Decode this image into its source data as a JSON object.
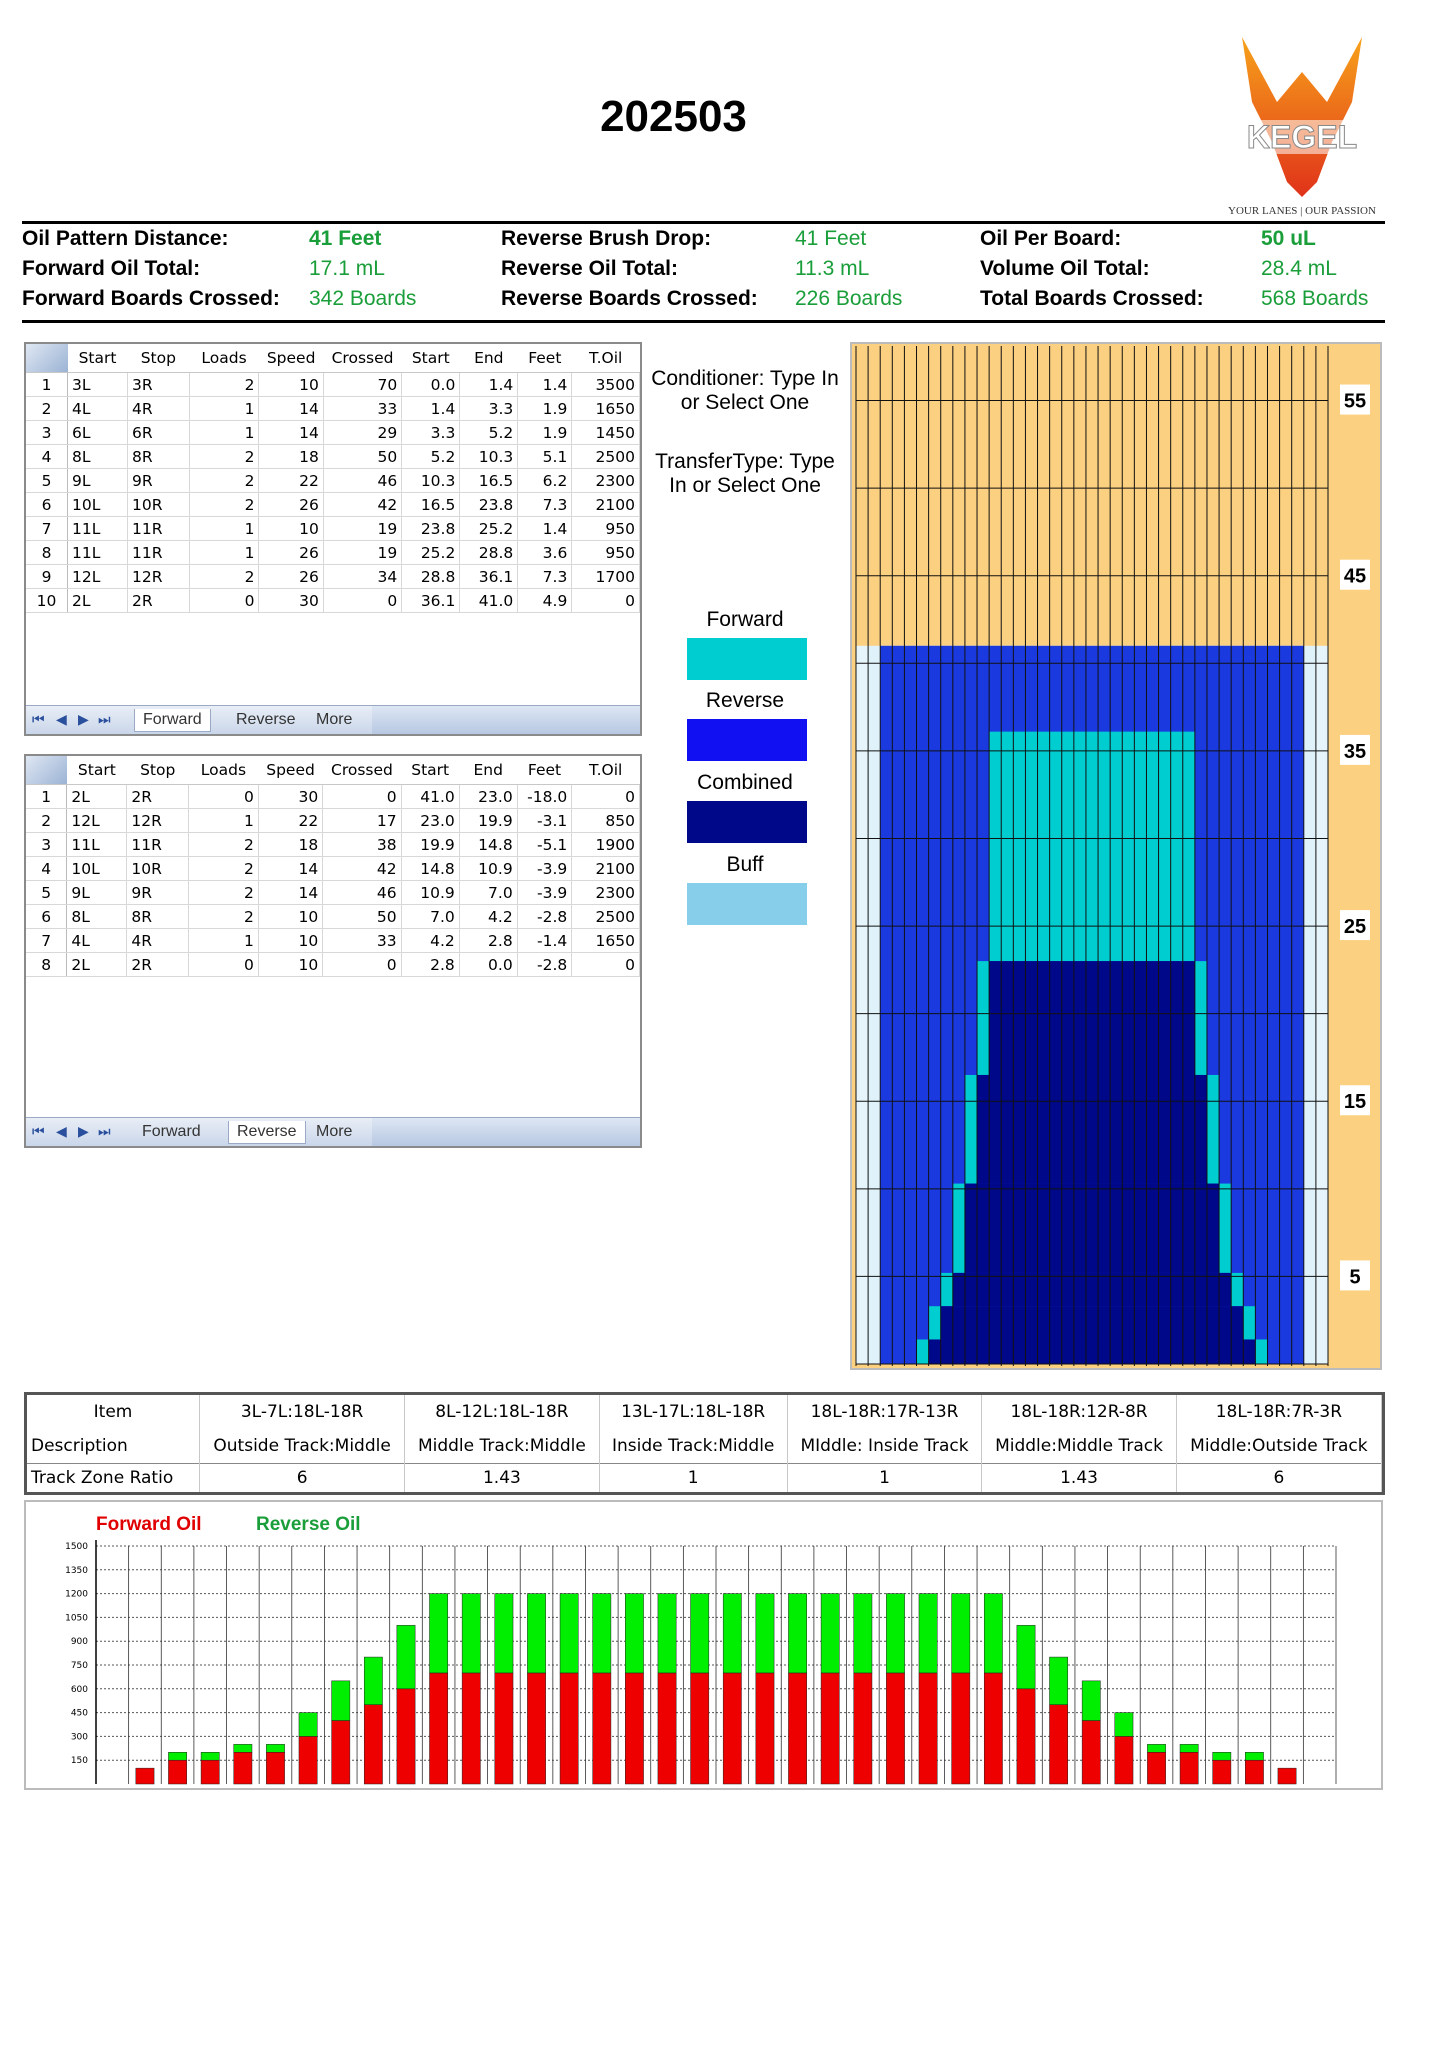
{
  "title": "202503",
  "logo": {
    "text": "KEGEL",
    "tagline": "YOUR LANES | OUR PASSION"
  },
  "summary": [
    [
      {
        "label": "Oil Pattern Distance:",
        "value": "41 Feet",
        "bold": true
      },
      {
        "label": "Reverse Brush Drop:",
        "value": "41 Feet",
        "bold": false
      },
      {
        "label": "Oil Per Board:",
        "value": "50 uL",
        "bold": true
      }
    ],
    [
      {
        "label": "Forward Oil Total:",
        "value": "17.1 mL",
        "bold": false
      },
      {
        "label": "Reverse Oil Total:",
        "value": "11.3 mL",
        "bold": false
      },
      {
        "label": "Volume Oil Total:",
        "value": "28.4 mL",
        "bold": false
      }
    ],
    [
      {
        "label": "Forward Boards Crossed:",
        "value": "342 Boards",
        "bold": false
      },
      {
        "label": "Reverse Boards Crossed:",
        "value": "226 Boards",
        "bold": false
      },
      {
        "label": "Total Boards Crossed:",
        "value": "568 Boards",
        "bold": false
      }
    ]
  ],
  "grid_headers": [
    "Start",
    "Stop",
    "Loads",
    "Speed",
    "Crossed",
    "Start",
    "End",
    "Feet",
    "T.Oil"
  ],
  "forward_rows": [
    [
      "1",
      "3L",
      "3R",
      "2",
      "10",
      "70",
      "0.0",
      "1.4",
      "1.4",
      "3500"
    ],
    [
      "2",
      "4L",
      "4R",
      "1",
      "14",
      "33",
      "1.4",
      "3.3",
      "1.9",
      "1650"
    ],
    [
      "3",
      "6L",
      "6R",
      "1",
      "14",
      "29",
      "3.3",
      "5.2",
      "1.9",
      "1450"
    ],
    [
      "4",
      "8L",
      "8R",
      "2",
      "18",
      "50",
      "5.2",
      "10.3",
      "5.1",
      "2500"
    ],
    [
      "5",
      "9L",
      "9R",
      "2",
      "22",
      "46",
      "10.3",
      "16.5",
      "6.2",
      "2300"
    ],
    [
      "6",
      "10L",
      "10R",
      "2",
      "26",
      "42",
      "16.5",
      "23.8",
      "7.3",
      "2100"
    ],
    [
      "7",
      "11L",
      "11R",
      "1",
      "10",
      "19",
      "23.8",
      "25.2",
      "1.4",
      "950"
    ],
    [
      "8",
      "11L",
      "11R",
      "1",
      "26",
      "19",
      "25.2",
      "28.8",
      "3.6",
      "950"
    ],
    [
      "9",
      "12L",
      "12R",
      "2",
      "26",
      "34",
      "28.8",
      "36.1",
      "7.3",
      "1700"
    ],
    [
      "10",
      "2L",
      "2R",
      "0",
      "30",
      "0",
      "36.1",
      "41.0",
      "4.9",
      "0"
    ]
  ],
  "reverse_rows": [
    [
      "1",
      "2L",
      "2R",
      "0",
      "30",
      "0",
      "41.0",
      "23.0",
      "-18.0",
      "0"
    ],
    [
      "2",
      "12L",
      "12R",
      "1",
      "22",
      "17",
      "23.0",
      "19.9",
      "-3.1",
      "850"
    ],
    [
      "3",
      "11L",
      "11R",
      "2",
      "18",
      "38",
      "19.9",
      "14.8",
      "-5.1",
      "1900"
    ],
    [
      "4",
      "10L",
      "10R",
      "2",
      "14",
      "42",
      "14.8",
      "10.9",
      "-3.9",
      "2100"
    ],
    [
      "5",
      "9L",
      "9R",
      "2",
      "14",
      "46",
      "10.9",
      "7.0",
      "-3.9",
      "2300"
    ],
    [
      "6",
      "8L",
      "8R",
      "2",
      "10",
      "50",
      "7.0",
      "4.2",
      "-2.8",
      "2500"
    ],
    [
      "7",
      "4L",
      "4R",
      "1",
      "10",
      "33",
      "4.2",
      "2.8",
      "-1.4",
      "1650"
    ],
    [
      "8",
      "2L",
      "2R",
      "0",
      "10",
      "0",
      "2.8",
      "0.0",
      "-2.8",
      "0"
    ]
  ],
  "tabs": [
    "Forward",
    "Reverse",
    "More"
  ],
  "conditioner_text": "Conditioner: Type In or Select One",
  "transfer_text": "TransferType: Type In or Select One",
  "legend": [
    {
      "label": "Forward",
      "color": "#00cdd0"
    },
    {
      "label": "Reverse",
      "color": "#1010f2"
    },
    {
      "label": "Combined",
      "color": "#00088a"
    },
    {
      "label": "Buff",
      "color": "#87ceeb"
    }
  ],
  "lane_scale": [
    "55",
    "45",
    "35",
    "25",
    "15",
    "5"
  ],
  "ratio_table": {
    "item_label": "Item",
    "desc_label": "Description",
    "ratio_label": "Track Zone Ratio",
    "columns": [
      {
        "item": "3L-7L:18L-18R",
        "desc": "Outside Track:Middle",
        "ratio": "6"
      },
      {
        "item": "8L-12L:18L-18R",
        "desc": "Middle Track:Middle",
        "ratio": "1.43"
      },
      {
        "item": "13L-17L:18L-18R",
        "desc": "Inside Track:Middle",
        "ratio": "1"
      },
      {
        "item": "18L-18R:17R-13R",
        "desc": "MIddle: Inside Track",
        "ratio": "1"
      },
      {
        "item": "18L-18R:12R-8R",
        "desc": "Middle:Middle Track",
        "ratio": "1.43"
      },
      {
        "item": "18L-18R:7R-3R",
        "desc": "Middle:Outside Track",
        "ratio": "6"
      }
    ]
  },
  "chart_data": {
    "type": "bar",
    "stacked": true,
    "legend_position": "top-left",
    "series": [
      {
        "name": "Forward Oil",
        "color": "#ee0000",
        "values": [
          100,
          150,
          150,
          200,
          200,
          300,
          400,
          500,
          600,
          700,
          700,
          700,
          700,
          700,
          700,
          700,
          700,
          700,
          700,
          700,
          700,
          700,
          700,
          700,
          700,
          700,
          700,
          600,
          500,
          400,
          300,
          200,
          200,
          150,
          150,
          100
        ]
      },
      {
        "name": "Reverse Oil",
        "color": "#00ee00",
        "values": [
          0,
          50,
          50,
          50,
          50,
          150,
          250,
          300,
          400,
          500,
          500,
          500,
          500,
          500,
          500,
          500,
          500,
          500,
          500,
          500,
          500,
          500,
          500,
          500,
          500,
          500,
          500,
          400,
          300,
          250,
          150,
          50,
          50,
          50,
          50,
          0
        ]
      }
    ],
    "y_ticks": [
      150,
      300,
      450,
      600,
      750,
      900,
      1050,
      1200,
      1350,
      1500
    ],
    "ylim": [
      0,
      1500
    ],
    "grid": true
  }
}
